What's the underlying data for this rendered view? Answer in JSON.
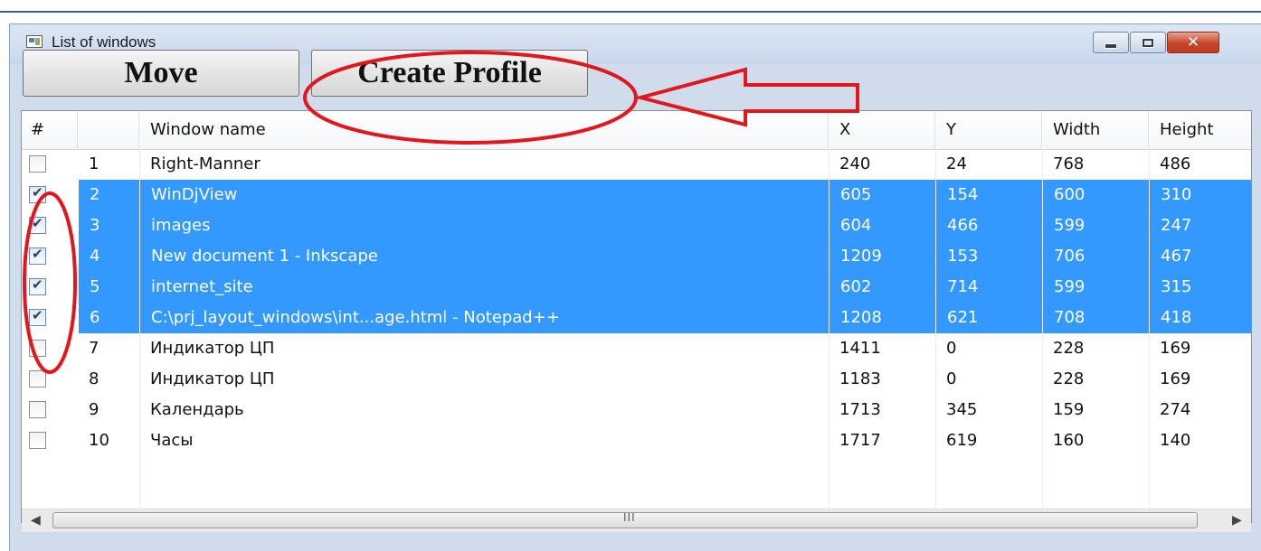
{
  "window": {
    "title": "List of windows",
    "minimize_label": "minimize",
    "maximize_label": "maximize",
    "close_label": "close"
  },
  "toolbar": {
    "move_label": "Move",
    "create_profile_label": "Create Profile"
  },
  "table": {
    "columns": [
      "#",
      "",
      "Window name",
      "X",
      "Y",
      "Width",
      "Height"
    ],
    "rows": [
      {
        "checked": false,
        "selected": false,
        "num": "1",
        "name": "Right-Manner",
        "x": "240",
        "y": "24",
        "width": "768",
        "height": "486"
      },
      {
        "checked": true,
        "selected": true,
        "num": "2",
        "name": "WinDjView",
        "x": "605",
        "y": "154",
        "width": "600",
        "height": "310"
      },
      {
        "checked": true,
        "selected": true,
        "num": "3",
        "name": "images",
        "x": "604",
        "y": "466",
        "width": "599",
        "height": "247"
      },
      {
        "checked": true,
        "selected": true,
        "num": "4",
        "name": "New document 1 - Inkscape",
        "x": "1209",
        "y": "153",
        "width": "706",
        "height": "467"
      },
      {
        "checked": true,
        "selected": true,
        "num": "5",
        "name": "internet_site",
        "x": "602",
        "y": "714",
        "width": "599",
        "height": "315"
      },
      {
        "checked": true,
        "selected": true,
        "num": "6",
        "name": "C:\\prj_layout_windows\\int...age.html - Notepad++",
        "x": "1208",
        "y": "621",
        "width": "708",
        "height": "418"
      },
      {
        "checked": false,
        "selected": false,
        "num": "7",
        "name": "Индикатор ЦП",
        "x": "1411",
        "y": "0",
        "width": "228",
        "height": "169"
      },
      {
        "checked": false,
        "selected": false,
        "num": "8",
        "name": "Индикатор ЦП",
        "x": "1183",
        "y": "0",
        "width": "228",
        "height": "169"
      },
      {
        "checked": false,
        "selected": false,
        "num": "9",
        "name": "Календарь",
        "x": "1713",
        "y": "345",
        "width": "159",
        "height": "274"
      },
      {
        "checked": false,
        "selected": false,
        "num": "10",
        "name": "Часы",
        "x": "1717",
        "y": "619",
        "width": "160",
        "height": "140"
      }
    ]
  },
  "scrollbar": {
    "grip": "III"
  },
  "colors": {
    "selection": "#3399ff",
    "annotation": "#e3161b",
    "close_button": "#c6452a"
  }
}
